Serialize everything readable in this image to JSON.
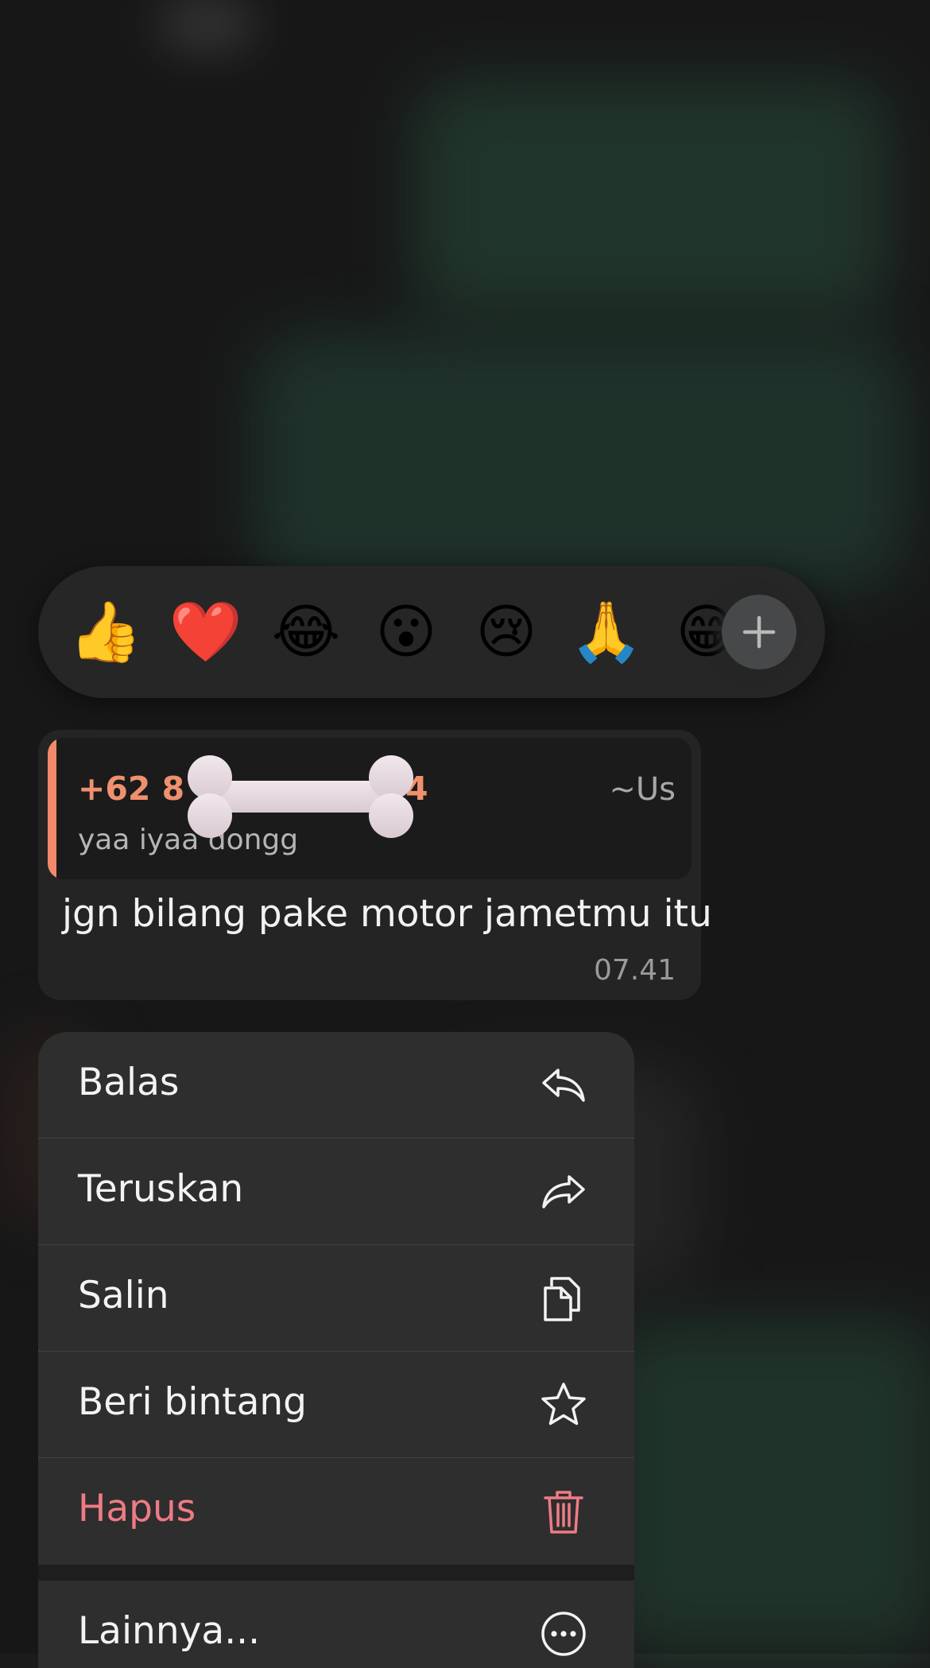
{
  "reactions": {
    "emojis": [
      "👍",
      "❤️",
      "😂",
      "😮",
      "😢",
      "🙏",
      "😁"
    ],
    "add_icon": "plus-icon"
  },
  "message": {
    "quoted": {
      "sender_prefix": "+62 8",
      "sender_suffix": "4",
      "alias": "~Us",
      "text": "yaa iyaa dongg",
      "accent_color": "#f08a6a"
    },
    "text": "jgn bilang pake motor jametmu itu",
    "time": "07.41"
  },
  "menu": {
    "items": [
      {
        "label": "Balas",
        "icon": "reply-icon"
      },
      {
        "label": "Teruskan",
        "icon": "forward-icon"
      },
      {
        "label": "Salin",
        "icon": "copy-icon"
      },
      {
        "label": "Beri bintang",
        "icon": "star-icon"
      },
      {
        "label": "Hapus",
        "icon": "trash-icon",
        "color": "#ef7b85"
      },
      {
        "label": "Lainnya...",
        "icon": "more-icon"
      }
    ]
  }
}
